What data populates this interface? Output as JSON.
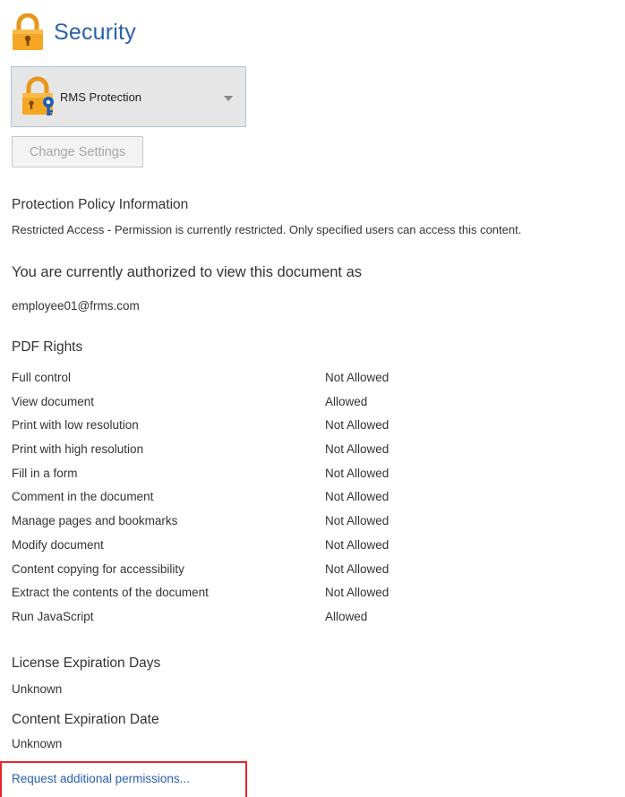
{
  "header": {
    "title": "Security",
    "icon": "lock-icon"
  },
  "protection_dropdown": {
    "selected": "RMS Protection",
    "icon": "rms-lock-key-icon"
  },
  "change_settings_button": {
    "label": "Change Settings",
    "disabled": true
  },
  "policy": {
    "heading": "Protection Policy Information",
    "description": "Restricted Access - Permission is currently restricted. Only specified users can access this content."
  },
  "authorization": {
    "heading": "You are currently authorized to view this document as",
    "user": "employee01@frms.com"
  },
  "pdf_rights": {
    "heading": "PDF Rights",
    "rows": [
      {
        "name": "Full control",
        "value": "Not Allowed"
      },
      {
        "name": "View document",
        "value": "Allowed"
      },
      {
        "name": "Print with low resolution",
        "value": "Not Allowed"
      },
      {
        "name": "Print with high resolution",
        "value": "Not Allowed"
      },
      {
        "name": "Fill in a form",
        "value": "Not Allowed"
      },
      {
        "name": "Comment in the document",
        "value": "Not Allowed"
      },
      {
        "name": "Manage pages and bookmarks",
        "value": "Not Allowed"
      },
      {
        "name": "Modify document",
        "value": "Not Allowed"
      },
      {
        "name": "Content copying for accessibility",
        "value": "Not Allowed"
      },
      {
        "name": "Extract the contents of the document",
        "value": "Not Allowed"
      },
      {
        "name": "Run JavaScript",
        "value": "Allowed"
      }
    ]
  },
  "license_expiration": {
    "heading": "License Expiration Days",
    "value": "Unknown"
  },
  "content_expiration": {
    "heading": "Content Expiration Date",
    "value": "Unknown"
  },
  "request_link": {
    "label": "Request additional permissions..."
  },
  "colors": {
    "title_blue": "#2a62a8",
    "link_blue": "#2a5db0",
    "lock_orange": "#f5a623",
    "highlight_red": "#e8232a",
    "dropdown_bg": "#e6e6e6",
    "dropdown_border": "#a9c4e3"
  }
}
